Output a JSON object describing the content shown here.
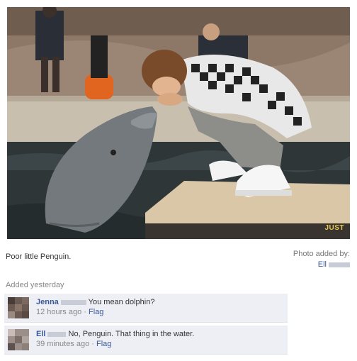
{
  "photo": {
    "alt_subject": "photo",
    "watermark": "JUST"
  },
  "caption": "Poor little Penguin.",
  "added_by": {
    "label": "Photo added by:",
    "name": "Ell"
  },
  "timestamp": "Added yesterday",
  "comments": [
    {
      "author": "Jenna",
      "text": "You mean dolphin?",
      "time": "12 hours ago",
      "separator": "·",
      "flag": "Flag"
    },
    {
      "author": "Ell",
      "text": "No, Penguin. That thing in the water.",
      "time": "39 minutes ago",
      "separator": "·",
      "flag": "Flag"
    }
  ],
  "colors": {
    "link": "#3b5998",
    "comment_bg": "#edeff4"
  }
}
